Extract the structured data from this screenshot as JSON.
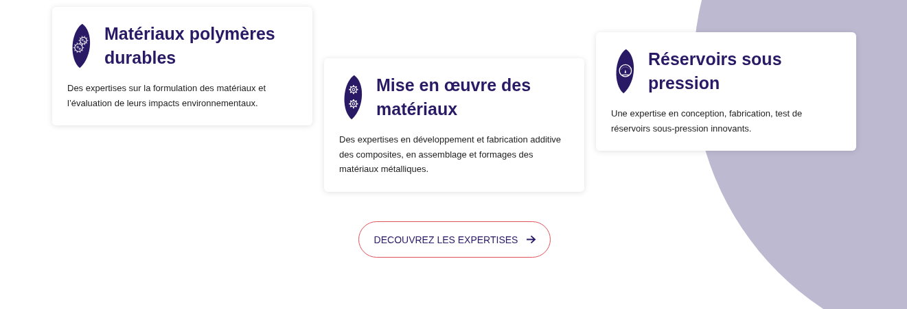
{
  "cards": [
    {
      "title": "Matériaux polymères durables",
      "text": "Des expertises sur la formulation des matériaux et l’évaluation de leurs impacts environnementaux."
    },
    {
      "title": "Mise en œuvre des matériaux",
      "text": "Des expertises en développement et fabrication additive des composites, en assemblage et formages des matériaux métalliques."
    },
    {
      "title": "Réservoirs sous pression",
      "text": "Une expertise en conception, fabrication, test de réservoirs sous-pression innovants."
    }
  ],
  "button": {
    "label": "DECOUVREZ LES EXPERTISES"
  }
}
